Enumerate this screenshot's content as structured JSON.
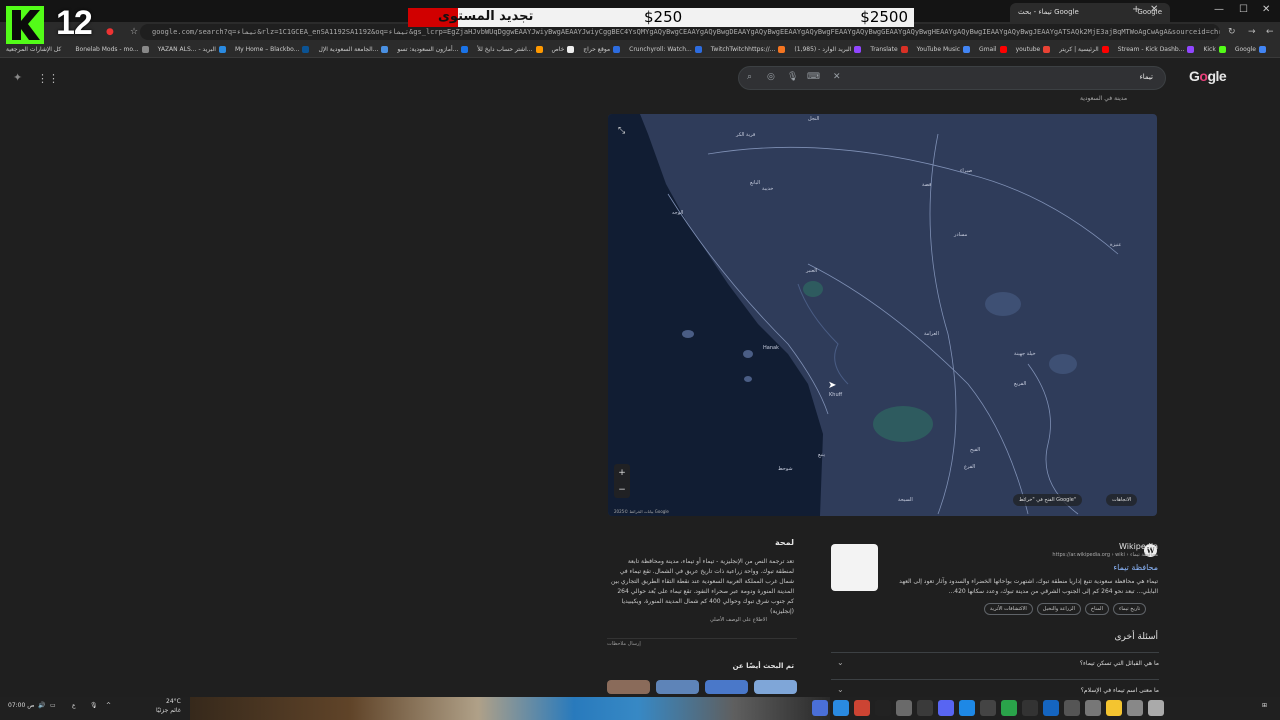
{
  "overlay": {
    "counter": "12",
    "bar_label": "تجديد المستوى",
    "bar_mid": "$250",
    "bar_right": "$2500"
  },
  "browser": {
    "tab_title": "تيماء - بحث Google",
    "tab_google": "Google",
    "url": "google.com/search?q=تيماء&rlz=1C1GCEA_enSA1192SA1192&oq=تيماء&gs_lcrp=EgZjaHJvbWUqDggwEAAYJwiyBwgAEAAYJwiyCggBEC4YsQMYgAQyBwgCEAAYgAQyBwgDEAAYgAQyBwgEEAAYgAQyBwgFEAAYgAQyBwgGEAAYgAQyBwgHEAAYgAQyBwgIEAAYgAQyBwgJEAAYgATSAQk2MjE3ajBqMTWoAgCwAgA&sourceid=chrome&ie=UTF-8",
    "bookmarks_right_label": "كل الإشارات المرجعية",
    "bookmarks": [
      "Google",
      "Kick",
      "Stream - Kick Dashb...",
      "الرئيسية | كريتر",
      "youtube",
      "Gmail",
      "YouTube Music",
      "Translate",
      "البريد الوارد - (1,985)",
      "TwitchTwitchhttps://...",
      "Crunchyroll: Watch...",
      "موقع حراج",
      "خاص",
      "اشتر حساب دايخ للأ...",
      "أمازون السعودية: تسو...",
      "الجامعة السعودية الإل...",
      "My Home – Blackbo...",
      "YAZAN ALS... - البريد",
      "Bonelab Mods - mo..."
    ]
  },
  "google": {
    "logo": "Google",
    "query": "تيماء",
    "top_hint": "مدينة في السعودية"
  },
  "map": {
    "labels": [
      {
        "text": "قرية الكر",
        "cls": "a"
      },
      {
        "text": "النجل",
        "cls": "b"
      },
      {
        "text": "البانع",
        "cls": "c"
      },
      {
        "text": "خديبة",
        "cls": "d"
      },
      {
        "text": "الوجه",
        "cls": "e"
      },
      {
        "text": "العنبر",
        "cls": "f"
      },
      {
        "text": "عنيزة",
        "cls": "g"
      },
      {
        "text": "صيراء",
        "cls": "h"
      },
      {
        "text": "مسادر",
        "cls": "i"
      },
      {
        "text": "Hanak",
        "cls": "j"
      },
      {
        "text": "العرامة",
        "cls": "k"
      },
      {
        "text": "Khuff",
        "cls": "l"
      },
      {
        "text": "خيلة جهينة",
        "cls": "m"
      },
      {
        "text": "الفريع",
        "cls": "n"
      },
      {
        "text": "قصة",
        "cls": "o"
      },
      {
        "text": "شوحط",
        "cls": "p"
      },
      {
        "text": "ينبع",
        "cls": "q"
      },
      {
        "text": "السيحة",
        "cls": "r"
      },
      {
        "text": "الفرع",
        "cls": "s"
      },
      {
        "text": "الفيح",
        "cls": "t"
      }
    ],
    "expand_chip": "الاتجاهات",
    "open_chip": "الفتح في \"خرائط Google\"",
    "attribution": "بيانات الخرائط ©2025 Google",
    "zoom_in": "+",
    "zoom_out": "−"
  },
  "knowledge": {
    "title": "لمحة",
    "description": "تعد ترجمة النص من الإنجليزية - تيماء أو تيماء، مدينة ومحافظة تابعة لمنطقة تبوك. وواحة زراعية ذات تاريخ عريق في الشمال. تقع تيماء في شمال غرب المملكة العربية السعودية عند نقطة التقاء الطريق التجاري بين المدينة المنورة ودومة عبر صحراء النفود. تقع تيماء على بُعد حوالي 264 كم جنوب شرق تبوك وحوالي 400 كم شمال المدينة المنورة. ويكيبيديا (إنجليزية)",
    "more": "الاطلاع على الوصف الأصلي",
    "feedback": "إرسال ملاحظات",
    "also_searched": "تم البحث أيضًا عن"
  },
  "wiki": {
    "source": "Wikipedia",
    "url": "https://ar.wikipedia.org › wiki › محافظة تيماء",
    "link": "محافظة تيماء",
    "description": "تيماء هي محافظة سعودية تتبع إداريا منطقة تبوك، اشتهرت بواحاتها الخضراء والسدود وآثار تعود إلى العهد البابلي... تبعد نحو 264 كم إلى الجنوب الشرقي من مدينة تبوك، وعدد سكانها 420...",
    "chips": [
      "تاريخ تيماء",
      "المناخ",
      "الزراعة والنخيل",
      "الاكتشافات الأثرية"
    ]
  },
  "paa": {
    "title": "أسئلة أخرى",
    "questions": [
      "ما هي القبائل التي تسكن تيماء؟",
      "ما معنى اسم تيماء في الإسلام؟"
    ]
  },
  "taskbar": {
    "weather": "24°C",
    "weather_sub": "غائم جزئيًا",
    "clock": "07:00 ص",
    "lang": "ع"
  }
}
